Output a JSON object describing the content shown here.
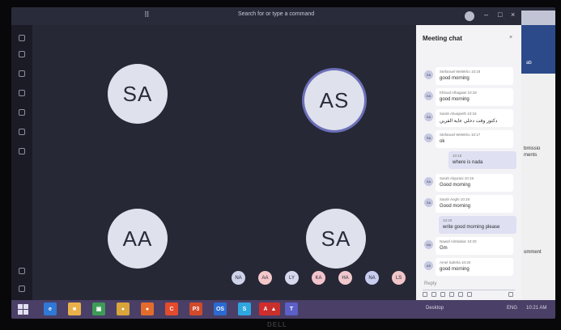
{
  "titlebar": {
    "search_placeholder": "Search for or type a command"
  },
  "participants": {
    "tiles": [
      {
        "initials": "SA",
        "speaking": false
      },
      {
        "initials": "AS",
        "speaking": true
      },
      {
        "initials": "AA",
        "speaking": false
      },
      {
        "initials": "SA",
        "speaking": false
      }
    ],
    "chips": [
      {
        "initials": "NA",
        "color": "#cfd3ea"
      },
      {
        "initials": "AA",
        "color": "#f4c7c9"
      },
      {
        "initials": "LY",
        "color": "#d6d8ee"
      },
      {
        "initials": "KA",
        "color": "#f2c4cc"
      },
      {
        "initials": "HA",
        "color": "#f0c9cd"
      },
      {
        "initials": "NA",
        "color": "#c9cdef"
      },
      {
        "initials": "LS",
        "color": "#f1c6c8"
      }
    ]
  },
  "chat": {
    "title": "Meeting chat",
    "messages": [
      {
        "avatar": "SA",
        "meta": "Stefanuel Welekho  10:18",
        "body": "good morning"
      },
      {
        "avatar": "KA",
        "meta": "Khloud Alhagawi  10:18",
        "body": "good morning"
      },
      {
        "avatar": "SA",
        "meta": "Sarah Abuajeelh  10:18",
        "body": "دكتور وقت دخلي عاية القرين"
      },
      {
        "avatar": "SA",
        "meta": "Stefanuel Welekho  10:17",
        "body": "ok"
      },
      {
        "mine": true,
        "meta": "10:18",
        "body": "where is nada"
      },
      {
        "avatar": "SA",
        "meta": "Sarah Alqurani  10:19",
        "body": "Good morning"
      },
      {
        "avatar": "SA",
        "meta": "Sarah Anghi  10:19",
        "body": "Good morning"
      },
      {
        "mine": true,
        "meta": "10:20",
        "body": "write good morning please"
      },
      {
        "avatar": "NA",
        "meta": "Nawaf Almbabar  10:20",
        "body": "Gm"
      },
      {
        "avatar": "AS",
        "meta": "Amel Safeha  10:20",
        "body": "good morning"
      }
    ],
    "reply_placeholder": "Reply"
  },
  "background_window": {
    "tab": "ab",
    "snippets": [
      "bmissio",
      "ments",
      "omment"
    ]
  },
  "taskbar": {
    "apps": [
      {
        "name": "ie",
        "label": "e",
        "color": "#2f78d6"
      },
      {
        "name": "files",
        "label": "■",
        "color": "#e9b14a"
      },
      {
        "name": "store",
        "label": "▣",
        "color": "#3d9c55"
      },
      {
        "name": "chrome",
        "label": "●",
        "color": "#d9a43a"
      },
      {
        "name": "firefox",
        "label": "●",
        "color": "#e36c2c"
      },
      {
        "name": "browser",
        "label": "C",
        "color": "#e34b2c"
      },
      {
        "name": "powerpoint",
        "label": "P3",
        "color": "#d04a2a"
      },
      {
        "name": "outlook",
        "label": "OS",
        "color": "#2b6bd1"
      },
      {
        "name": "skype",
        "label": "S",
        "color": "#2ea7e0"
      },
      {
        "name": "acrobat",
        "label": "A",
        "color": "#d22c2c"
      },
      {
        "name": "photos",
        "label": "▲",
        "color": "#c9302c"
      },
      {
        "name": "teams",
        "label": "T",
        "color": "#5b5fc7"
      }
    ],
    "tray_left": "Desktop",
    "tray_lang": "ENG",
    "clock": "10:21 AM"
  },
  "monitor_brand": "DELL"
}
